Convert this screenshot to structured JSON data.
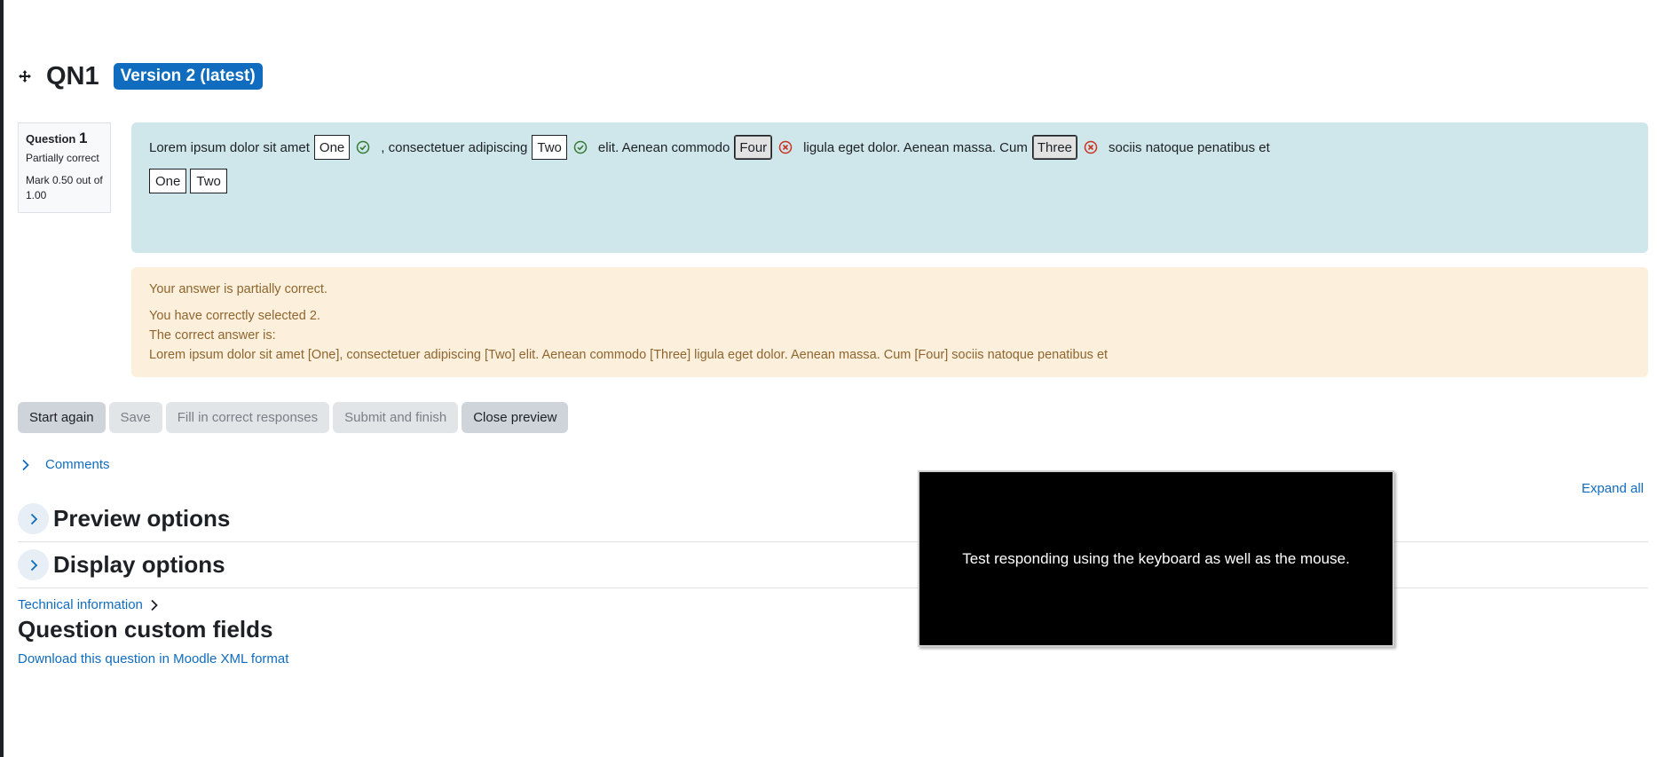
{
  "colors": {
    "formulation_bg": "#cfe7ea",
    "feedback_bg": "#fcefdc",
    "feedback_text": "#8e662e",
    "link": "#0f6cbf",
    "badge": "#0f6cbf",
    "correct_icon": "#357a32",
    "incorrect_icon": "#ca3120"
  },
  "header": {
    "move_icon": "move-arrows-icon",
    "title": "QN1",
    "version_badge": "Version 2 (latest)"
  },
  "info": {
    "question_label": "Question",
    "question_number": "1",
    "state": "Partially correct",
    "grade": "Mark 0.50 out of 1.00"
  },
  "question": {
    "text_1": "Lorem ipsum dolor sit amet",
    "drop_1": "One",
    "drop_1_status": "correct",
    "text_2": ", consectetuer adipiscing",
    "drop_2": "Two",
    "drop_2_status": "correct",
    "text_3": "elit. Aenean commodo",
    "drop_3": "Four",
    "drop_3_status": "incorrect",
    "text_4": "ligula eget dolor. Aenean massa. Cum",
    "drop_4": "Three",
    "drop_4_status": "incorrect",
    "text_5": "sociis natoque penatibus et",
    "choices": [
      "One",
      "Two"
    ]
  },
  "feedback": {
    "general": "Your answer is partially correct.",
    "num_correct": "You have correctly selected 2.",
    "right_answer_label": "The correct answer is:",
    "right_answer": "Lorem ipsum dolor sit amet [One], consectetuer adipiscing [Two] elit. Aenean commodo [Three] ligula eget dolor. Aenean massa. Cum [Four] sociis natoque penatibus et"
  },
  "buttons": {
    "start_again": "Start again",
    "save": "Save",
    "fill_correct": "Fill in correct responses",
    "submit_finish": "Submit and finish",
    "close_preview": "Close preview"
  },
  "comments_label": "Comments",
  "expand_all": "Expand all",
  "sections": {
    "preview_options": "Preview options",
    "display_options": "Display options"
  },
  "technical_information": "Technical information",
  "custom_fields_title": "Question custom fields",
  "download_link": "Download this question in Moodle XML format",
  "overlay_text": "Test responding using the keyboard as well as the mouse."
}
